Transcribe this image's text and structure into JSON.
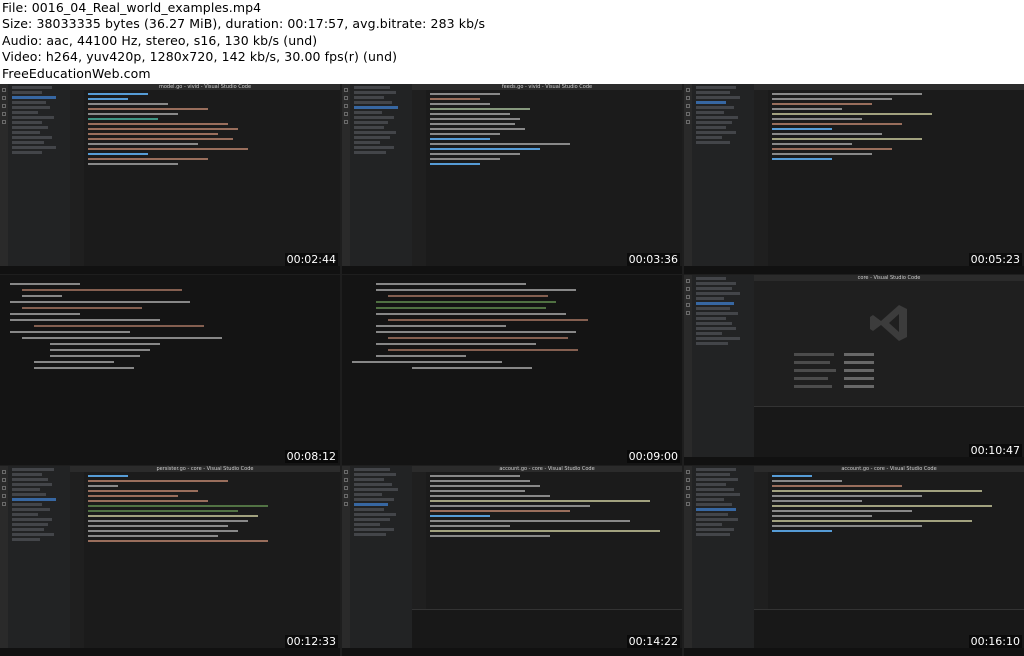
{
  "header": {
    "file": "File: 0016_04_Real_world_examples.mp4",
    "size": "Size: 38033335 bytes (36.27 MiB), duration: 00:17:57, avg.bitrate: 283 kb/s",
    "audio": "Audio: aac, 44100 Hz, stereo, s16, 130 kb/s (und)",
    "video": "Video: h264, yuv420p, 1280x720, 142 kb/s, 30.00 fps(r) (und)",
    "site": "FreeEducationWeb.com"
  },
  "tiles": [
    {
      "title": "model.go - vivid - Visual Studio Code",
      "timestamp": "00:02:44",
      "kind": "editor"
    },
    {
      "title": "feeds.go - vivid - Visual Studio Code",
      "timestamp": "00:03:36",
      "kind": "editor"
    },
    {
      "title": "",
      "timestamp": "00:05:23",
      "kind": "editor"
    },
    {
      "title": "",
      "timestamp": "00:08:12",
      "kind": "terminal"
    },
    {
      "title": "",
      "timestamp": "00:09:00",
      "kind": "terminal"
    },
    {
      "title": "core - Visual Studio Code",
      "timestamp": "00:10:47",
      "kind": "welcome"
    },
    {
      "title": "persister.go - core - Visual Studio Code",
      "timestamp": "00:12:33",
      "kind": "editor"
    },
    {
      "title": "account.go - core - Visual Studio Code",
      "timestamp": "00:14:22",
      "kind": "editor"
    },
    {
      "title": "account.go - core - Visual Studio Code",
      "timestamp": "00:16:10",
      "kind": "editor"
    }
  ],
  "colors": {
    "editor_bg": "#1b1b1b",
    "keyword": "#569cd6",
    "string": "#ce9178",
    "type": "#4ec9b0",
    "text": "#d4d4d4",
    "status_green": "#4caf50"
  }
}
